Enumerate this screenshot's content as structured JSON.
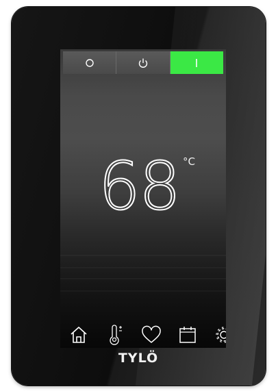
{
  "tabs": [
    {
      "id": "off",
      "icon": "circle-icon",
      "active": false
    },
    {
      "id": "standby",
      "icon": "power-icon",
      "active": false
    },
    {
      "id": "on",
      "icon": "line-icon",
      "active": true
    }
  ],
  "colors": {
    "active_tab": "#3be845",
    "tab_bg": "#4f4f4f",
    "icon_color": "#ffffff"
  },
  "temperature": {
    "value": "68",
    "unit": "°C"
  },
  "nav": [
    {
      "id": "home",
      "icon": "home-icon"
    },
    {
      "id": "temperature",
      "icon": "thermometer-icon"
    },
    {
      "id": "favorites",
      "icon": "heart-icon"
    },
    {
      "id": "calendar",
      "icon": "calendar-icon"
    },
    {
      "id": "settings",
      "icon": "gear-icon"
    }
  ],
  "brand": "TYLÖ"
}
